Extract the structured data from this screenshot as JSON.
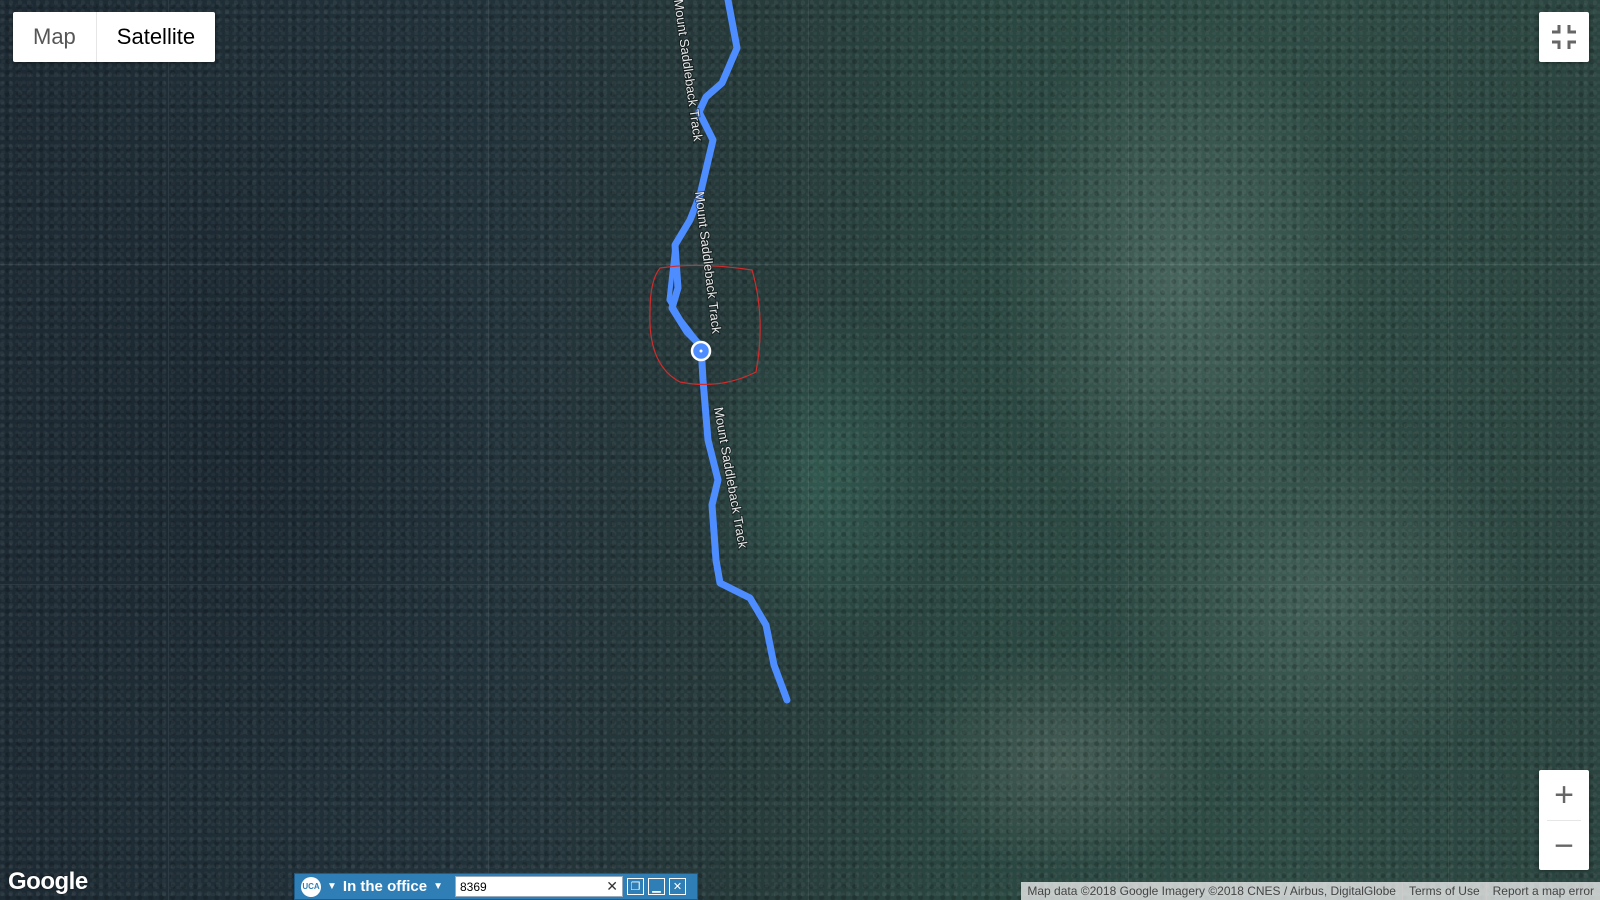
{
  "map": {
    "type_control": {
      "map_label": "Map",
      "satellite_label": "Satellite",
      "active": "Satellite"
    },
    "track_labels": [
      "Mount Saddleback Track",
      "Mount Saddleback Track",
      "Mount Saddleback Track"
    ],
    "route_color": "#4d8dff",
    "marker_color": "#4d8dff",
    "circle_color": "#d22b2b",
    "zoom": {
      "in_label": "+",
      "out_label": "−"
    },
    "logo": "Google",
    "attribution": {
      "data": "Map data ©2018 Google Imagery ©2018 CNES / Airbus, DigitalGlobe",
      "terms": "Terms of Use",
      "report": "Report a map error"
    }
  },
  "statusbar": {
    "logo_text": "UCA",
    "status": "In the office",
    "input_value": "8369",
    "clear_icon": "close-icon",
    "buttons": [
      "restore-icon",
      "minimize-icon",
      "close-icon"
    ]
  }
}
